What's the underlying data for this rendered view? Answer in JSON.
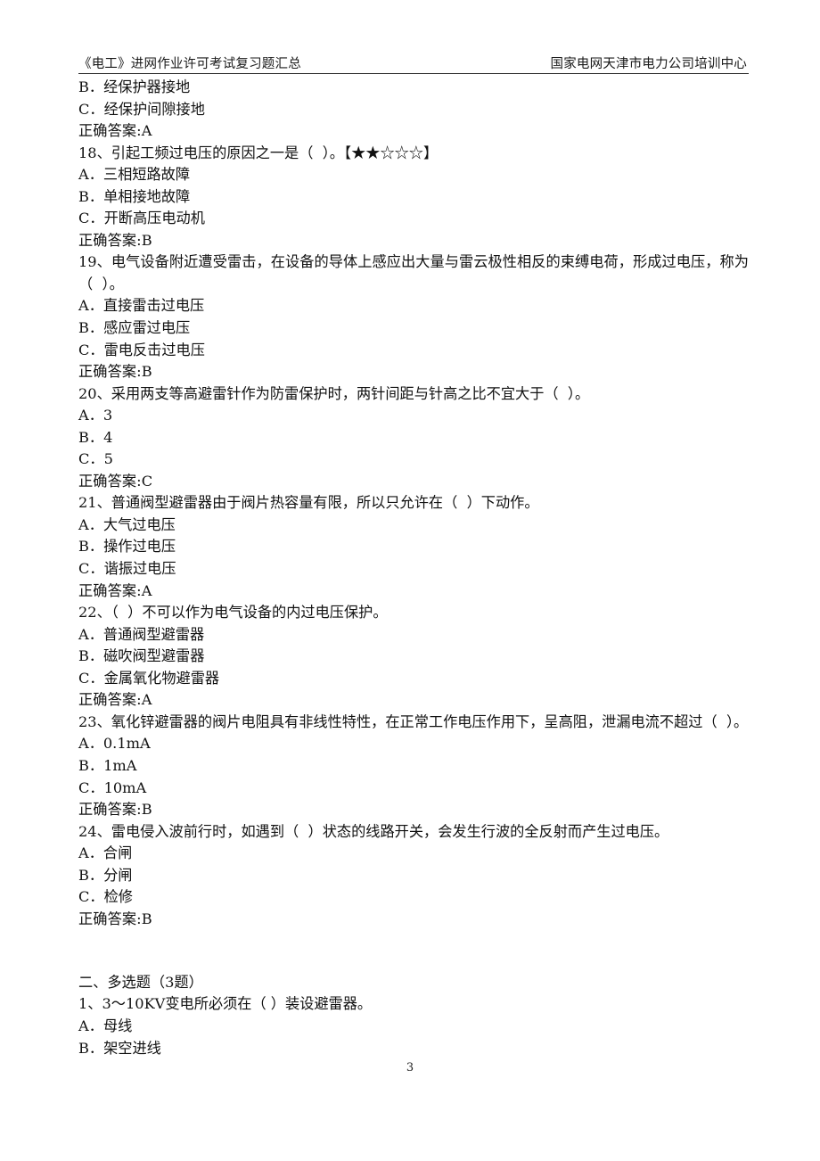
{
  "header": {
    "left_title": "《电工》进网作业许可考试复习题汇总",
    "right_title": "国家电网天津市电力公司培训中心"
  },
  "footer": {
    "page_number": "3"
  },
  "body": {
    "continued_options": [
      "B．经保护器接地",
      "C．经保护间隙接地"
    ],
    "continued_answer": "正确答案:A",
    "questions": [
      {
        "stem": "18、引起工频过电压的原因之一是（  ）。【★★☆☆☆】",
        "options": [
          "A．三相短路故障",
          "B．单相接地故障",
          "C．开断高压电动机"
        ],
        "answer": "正确答案:B"
      },
      {
        "stem": "19、电气设备附近遭受雷击，在设备的导体上感应出大量与雷云极性相反的束缚电荷，形成过电压，称为（  ）。",
        "options": [
          "A．直接雷击过电压",
          "B．感应雷过电压",
          "C．雷电反击过电压"
        ],
        "answer": "正确答案:B"
      },
      {
        "stem": "20、采用两支等高避雷针作为防雷保护时，两针间距与针高之比不宜大于（  ）。",
        "options": [
          "A．3",
          "B．4",
          "C．5"
        ],
        "answer": "正确答案:C"
      },
      {
        "stem": "21、普通阀型避雷器由于阀片热容量有限，所以只允许在（  ）下动作。",
        "options": [
          "A．大气过电压",
          "B．操作过电压",
          "C．谐振过电压"
        ],
        "answer": "正确答案:A"
      },
      {
        "stem": "22、（  ）不可以作为电气设备的内过电压保护。",
        "options": [
          "A．普通阀型避雷器",
          "B．磁吹阀型避雷器",
          "C．金属氧化物避雷器"
        ],
        "answer": "正确答案:A"
      },
      {
        "stem": "23、氧化锌避雷器的阀片电阻具有非线性特性，在正常工作电压作用下，呈高阻，泄漏电流不超过（  ）。",
        "options": [
          "A．0.1mA",
          "B．1mA",
          "C．10mA"
        ],
        "answer": "正确答案:B"
      },
      {
        "stem": "24、雷电侵入波前行时，如遇到（  ）状态的线路开关，会发生行波的全反射而产生过电压。",
        "options": [
          "A．合闸",
          "B．分闸",
          "C．检修"
        ],
        "answer": "正确答案:B"
      }
    ],
    "section_heading": "二、多选题（3题）",
    "multi_questions": [
      {
        "stem": "1、3～10KV变电所必须在（ ）装设避雷器。",
        "options": [
          "A．母线",
          "B．架空进线"
        ]
      }
    ]
  }
}
